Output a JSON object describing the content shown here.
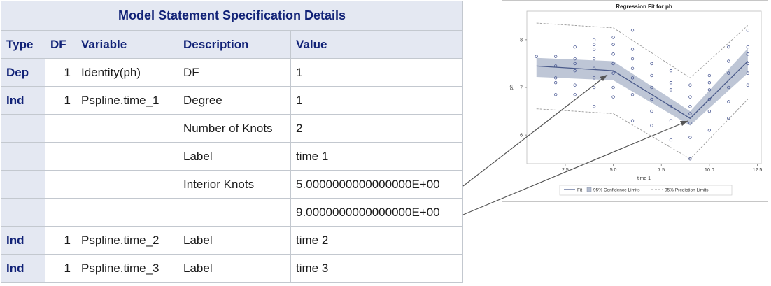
{
  "table": {
    "title": "Model Statement Specification Details",
    "headers": [
      "Type",
      "DF",
      "Variable",
      "Description",
      "Value"
    ],
    "rows": [
      {
        "type": "Dep",
        "df": "1",
        "variable": "Identity(ph)",
        "description": "DF",
        "value": "1"
      },
      {
        "type": "Ind",
        "df": "1",
        "variable": "Pspline.time_1",
        "description": "Degree",
        "value": "1"
      },
      {
        "type": "",
        "df": "",
        "variable": "",
        "description": "Number of Knots",
        "value": "2"
      },
      {
        "type": "",
        "df": "",
        "variable": "",
        "description": "Label",
        "value": "time 1"
      },
      {
        "type": "",
        "df": "",
        "variable": "",
        "description": "Interior Knots",
        "value": "5.0000000000000000E+00"
      },
      {
        "type": "",
        "df": "",
        "variable": "",
        "description": "",
        "value": "9.0000000000000000E+00"
      },
      {
        "type": "Ind",
        "df": "1",
        "variable": "Pspline.time_2",
        "description": "Label",
        "value": "time 2"
      },
      {
        "type": "Ind",
        "df": "1",
        "variable": "Pspline.time_3",
        "description": "Label",
        "value": "time 3"
      }
    ]
  },
  "chart_data": {
    "type": "scatter",
    "title": "Regression Fit for ph",
    "xlabel": "time 1",
    "ylabel": "ph",
    "xlim": [
      0.5,
      12.7
    ],
    "ylim": [
      5.4,
      8.6
    ],
    "x_ticks": [
      "2.5",
      "5.0",
      "7.5",
      "10.0",
      "12.5"
    ],
    "x_tick_values": [
      2.5,
      5.0,
      7.5,
      10.0,
      12.5
    ],
    "y_ticks": [
      "6",
      "7",
      "8"
    ],
    "y_tick_values": [
      6,
      7,
      8
    ],
    "legend": [
      "Fit",
      "95% Confidence Limits",
      "95% Prediction Limits"
    ],
    "legend_position": "bottom",
    "colors": {
      "fit": "#4a5a8a",
      "confidence": "#b3bccf",
      "prediction": "#999999",
      "points": "#3a4a8a",
      "arrows": "#555555"
    },
    "fit": {
      "x": [
        1,
        5,
        9,
        12
      ],
      "y": [
        7.45,
        7.35,
        6.35,
        7.55
      ]
    },
    "confidence": {
      "x": [
        1,
        5,
        9,
        12
      ],
      "upper": [
        7.62,
        7.55,
        6.5,
        7.82
      ],
      "lower": [
        7.22,
        7.15,
        6.2,
        7.3
      ]
    },
    "prediction": {
      "x": [
        1,
        5,
        9,
        12
      ],
      "upper": [
        8.35,
        8.25,
        7.2,
        8.3
      ],
      "lower": [
        6.55,
        6.45,
        5.5,
        6.75
      ]
    },
    "points": [
      [
        1,
        7.65
      ],
      [
        2,
        7.2
      ],
      [
        2,
        7.45
      ],
      [
        2,
        7.65
      ],
      [
        2,
        6.85
      ],
      [
        2,
        7.1
      ],
      [
        3,
        7.5
      ],
      [
        3,
        7.6
      ],
      [
        3,
        7.85
      ],
      [
        3,
        7.35
      ],
      [
        3,
        7.05
      ],
      [
        3,
        6.85
      ],
      [
        4,
        7.2
      ],
      [
        4,
        7.4
      ],
      [
        4,
        7.6
      ],
      [
        4,
        7.8
      ],
      [
        4,
        8.0
      ],
      [
        4,
        7.9
      ],
      [
        4,
        7.0
      ],
      [
        4,
        6.6
      ],
      [
        5,
        6.8
      ],
      [
        5,
        7.0
      ],
      [
        5,
        7.3
      ],
      [
        5,
        7.5
      ],
      [
        5,
        7.7
      ],
      [
        5,
        7.9
      ],
      [
        5,
        8.05
      ],
      [
        6,
        6.3
      ],
      [
        6,
        6.85
      ],
      [
        6,
        7.2
      ],
      [
        6,
        7.4
      ],
      [
        6,
        7.6
      ],
      [
        6,
        7.8
      ],
      [
        6,
        8.2
      ],
      [
        7,
        6.2
      ],
      [
        7,
        6.5
      ],
      [
        7,
        6.75
      ],
      [
        7,
        7.0
      ],
      [
        7,
        7.25
      ],
      [
        7,
        7.5
      ],
      [
        8,
        5.9
      ],
      [
        8,
        6.3
      ],
      [
        8,
        6.6
      ],
      [
        8,
        6.95
      ],
      [
        8,
        7.1
      ],
      [
        8,
        7.35
      ],
      [
        9,
        5.5
      ],
      [
        9,
        5.95
      ],
      [
        9,
        6.25
      ],
      [
        9,
        6.45
      ],
      [
        9,
        6.6
      ],
      [
        9,
        6.8
      ],
      [
        9,
        7.05
      ],
      [
        10,
        6.1
      ],
      [
        10,
        6.5
      ],
      [
        10,
        6.75
      ],
      [
        10,
        6.95
      ],
      [
        10,
        7.1
      ],
      [
        10,
        7.25
      ],
      [
        11,
        6.35
      ],
      [
        11,
        6.7
      ],
      [
        11,
        7.0
      ],
      [
        11,
        7.3
      ],
      [
        11,
        7.55
      ],
      [
        11,
        7.85
      ],
      [
        12,
        7.05
      ],
      [
        12,
        7.3
      ],
      [
        12,
        7.5
      ],
      [
        12,
        7.7
      ],
      [
        12,
        7.85
      ],
      [
        12,
        8.2
      ]
    ]
  }
}
